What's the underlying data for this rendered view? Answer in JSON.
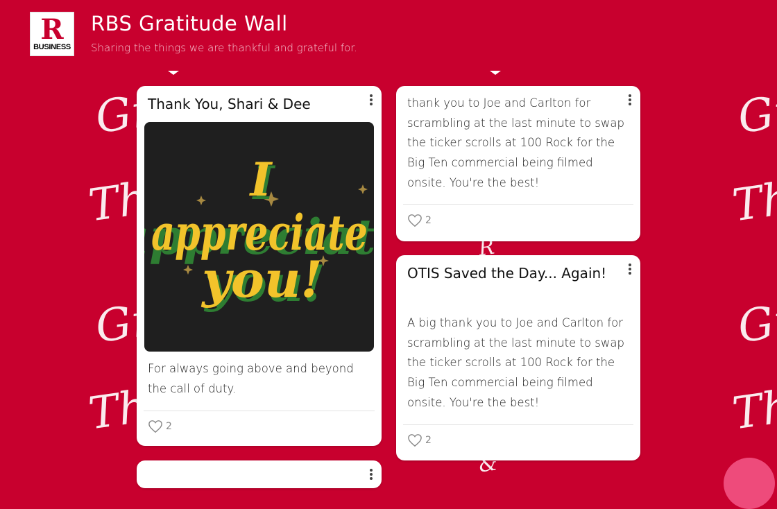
{
  "header": {
    "logo_letter": "R",
    "logo_sub": "BUSINESS",
    "title": "RBS Gratitude Wall",
    "subtitle": "Sharing the things we are thankful and grateful for."
  },
  "background": {
    "color": "#c8002e",
    "words": [
      "Gr",
      "Th",
      "Gr",
      "Th",
      "Gr",
      "Th",
      "Gr",
      "Th",
      "R",
      "&"
    ]
  },
  "cards": [
    {
      "title": "Thank You, Shari & Dee",
      "image_text": [
        "I",
        "appreciate",
        "you!"
      ],
      "body": "For always going above and beyond the call of duty.",
      "likes": "2"
    },
    {
      "title": "",
      "body": "thank you to Joe and Carlton for scrambling at the last minute to swap the ticker scrolls at 100 Rock for the Big Ten commercial being filmed onsite. You're the best!",
      "likes": "2"
    },
    {
      "title": "OTIS Saved the Day... Again!",
      "body": "A big thank you to Joe and Carlton for scrambling at the last minute to swap the ticker scrolls at 100 Rock for the Big Ten commercial being filmed onsite. You're the best!",
      "likes": "2"
    }
  ],
  "colors": {
    "accent": "#c8002e",
    "fab": "#ee4b7b",
    "image_yellow": "#f2c32b",
    "image_green": "#2e7d32"
  }
}
